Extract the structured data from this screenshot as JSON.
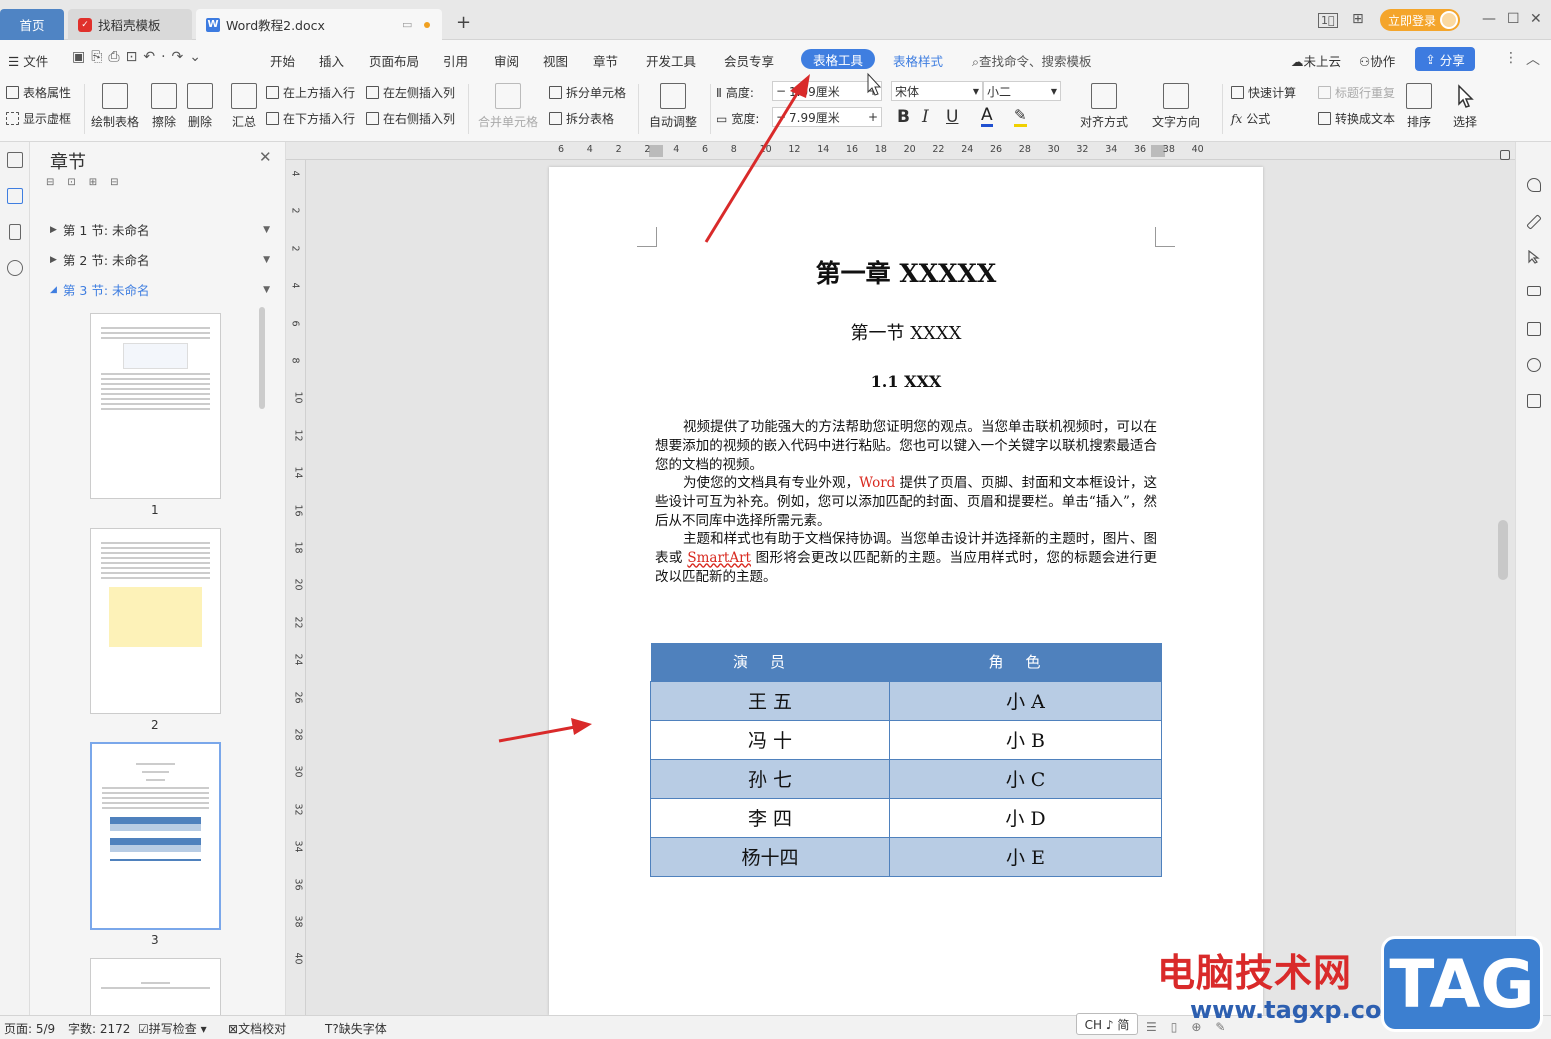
{
  "titlebar": {
    "tabs": [
      {
        "label": "首页"
      },
      {
        "label": "找稻壳模板"
      },
      {
        "label": "Word教程2.docx"
      }
    ],
    "new_tab": "+",
    "login": "立即登录"
  },
  "menubar": {
    "file": "文件",
    "items": [
      "开始",
      "插入",
      "页面布局",
      "引用",
      "审阅",
      "视图",
      "章节",
      "开发工具",
      "会员专享"
    ],
    "table_tools": "表格工具",
    "table_style": "表格样式",
    "search": "查找命令、搜索模板",
    "cloud": "未上云",
    "collab": "协作",
    "share": "分享"
  },
  "toolbar": {
    "table_props": "表格属性",
    "show_grid": "显示虚框",
    "draw_table": "绘制表格",
    "erase": "擦除",
    "delete": "删除",
    "summary": "汇总",
    "insert_above": "在上方插入行",
    "insert_below": "在下方插入行",
    "insert_left": "在左侧插入列",
    "insert_right": "在右侧插入列",
    "merge_cells": "合并单元格",
    "split_cells": "拆分单元格",
    "split_table": "拆分表格",
    "auto_fit": "自动调整",
    "height_label": "高度:",
    "height_value": "1.09厘米",
    "width_label": "宽度:",
    "width_value": "7.99厘米",
    "font": "宋体",
    "size": "小二",
    "bold": "B",
    "italic": "I",
    "underline": "U",
    "font_color": "A",
    "align": "对齐方式",
    "text_dir": "文字方向",
    "quick_calc": "快速计算",
    "repeat_header": "标题行重复",
    "formula": "公式",
    "to_text": "转换成文本",
    "sort": "排序",
    "select": "选择"
  },
  "nav": {
    "title": "章节",
    "sections": [
      "第 1 节: 未命名",
      "第 2 节: 未命名",
      "第 3 节: 未命名"
    ],
    "thumbs": [
      "1",
      "2",
      "3"
    ]
  },
  "ruler": {
    "h": [
      "6",
      "4",
      "2",
      "2",
      "4",
      "6",
      "8",
      "10",
      "12",
      "14",
      "16",
      "18",
      "20",
      "22",
      "24",
      "26",
      "28",
      "30",
      "32",
      "34",
      "36",
      "38",
      "40"
    ],
    "v": [
      "4",
      "2",
      "2",
      "4",
      "6",
      "8",
      "10",
      "12",
      "14",
      "16",
      "18",
      "20",
      "22",
      "24",
      "26",
      "28",
      "30",
      "32",
      "34",
      "36",
      "38",
      "40"
    ]
  },
  "document": {
    "h1": "第一章  XXXXX",
    "h2": "第一节  XXXX",
    "h3": "1.1 XXX",
    "p1": "视频提供了功能强大的方法帮助您证明您的观点。当您单击联机视频时，可以在想要添加的视频的嵌入代码中进行粘贴。您也可以键入一个关键字以联机搜索最适合您的文档的视频。",
    "p2a": "为使您的文档具有专业外观，",
    "p2word": "Word",
    "p2b": " 提供了页眉、页脚、封面和文本框设计，这些设计可互为补充。例如，您可以添加匹配的封面、页眉和提要栏。单击“插入”，然后从不同库中选择所需元素。",
    "p3a": "主题和样式也有助于文档保持协调。当您单击设计并选择新的主题时，图片、图表或 ",
    "p3smart": "SmartArt",
    "p3b": " 图形将会更改以匹配新的主题。当应用样式时，您的标题会进行更改以匹配新的主题。",
    "table": {
      "headers": [
        "演员",
        "角色"
      ],
      "rows": [
        [
          "王  五",
          "小  A"
        ],
        [
          "冯  十",
          "小  B"
        ],
        [
          "孙  七",
          "小  C"
        ],
        [
          "李  四",
          "小  D"
        ],
        [
          "杨十四",
          "小  E"
        ]
      ]
    }
  },
  "statusbar": {
    "page": "页面: 5/9",
    "words": "字数: 2172",
    "spell": "拼写检查",
    "proof": "文档校对",
    "missing_font": "缺失字体",
    "ime": "CH ♪ 简"
  },
  "watermark": {
    "text": "电脑技术网",
    "url": "www.tagxp.com",
    "tag": "TAG"
  },
  "colors": {
    "accent": "#3f7ee0",
    "table_header": "#4f81bd",
    "table_band": "#b8cce4",
    "arrow": "#d92a2a"
  }
}
